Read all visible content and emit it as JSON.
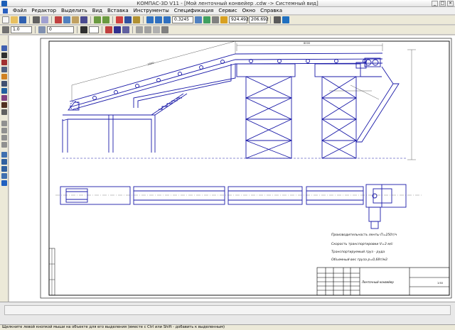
{
  "window": {
    "title": "КОМПАС-3D V11 - [Мой ленточный конвейер .cdw -> Системный вид]",
    "controls": [
      "_",
      "□",
      "×"
    ]
  },
  "menu": [
    "Файл",
    "Редактор",
    "Выделить",
    "Вид",
    "Вставка",
    "Инструменты",
    "Спецификация",
    "Сервис",
    "Окно",
    "Справка"
  ],
  "toolbar": {
    "zoom_value": "0.3245",
    "coord_x": "924.492",
    "coord_y": "206.692"
  },
  "toolbar2": {
    "line_style_value": "1.0",
    "layer_value": "0"
  },
  "drawing": {
    "notes": [
      "Производительность ленты  П=250т/ч",
      "Скорость транспортировки  V=3 м/с",
      "Транспортируемый груз - руда",
      "Объемный вес груза р=0,68т/м3"
    ],
    "stamp_title": "Ленточный конвейер",
    "stamp_scale": "1:50",
    "dim_top_left": "2000",
    "dim_top_right": "8000"
  },
  "statusbar": {
    "text": "Щелкните левой кнопкой мыши на объекте для его выделения (вместе с Ctrl или Shift - добавить к выделенным)"
  },
  "colors": {
    "drawing_line": "#1a1aa8",
    "frame": "#000000",
    "dimension": "#3a3a3a"
  }
}
